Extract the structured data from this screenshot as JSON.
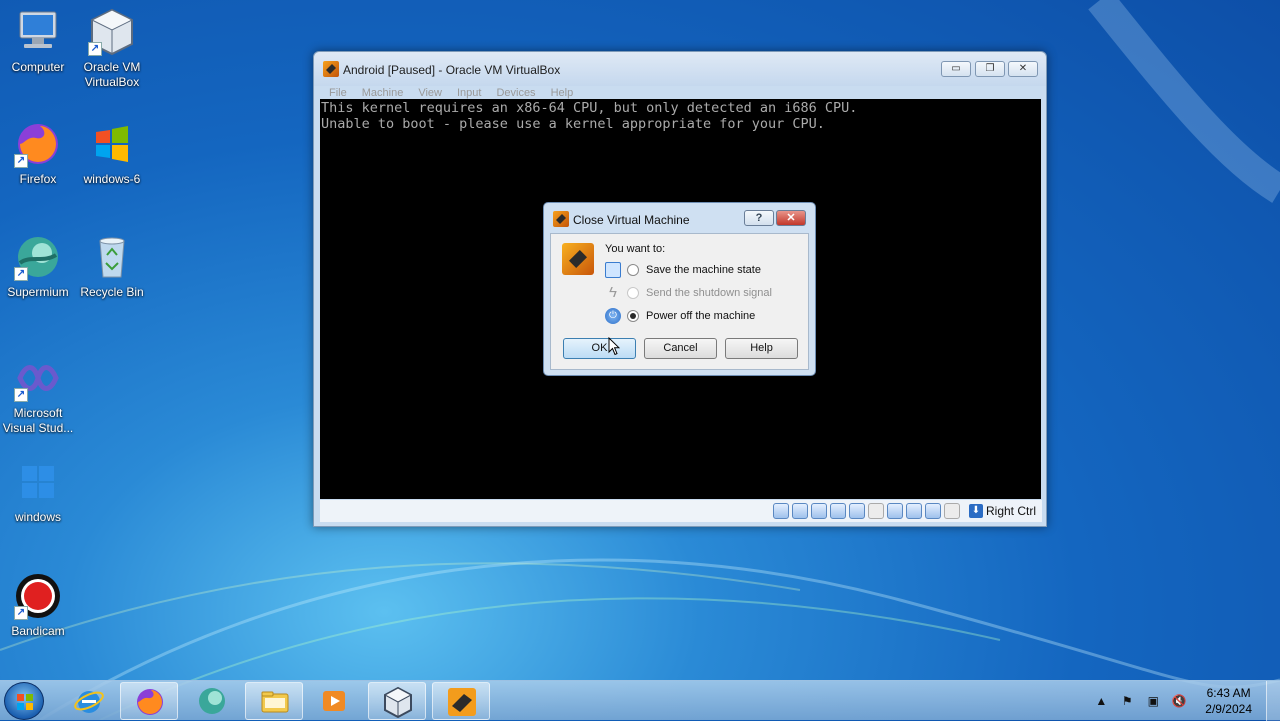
{
  "desktop": {
    "icons": [
      {
        "label": "Computer",
        "icon": "computer-icon"
      },
      {
        "label": "Oracle VM VirtualBox",
        "icon": "virtualbox-icon"
      },
      {
        "label": "Firefox",
        "icon": "firefox-icon"
      },
      {
        "label": "windows-6",
        "icon": "windows-logo-icon"
      },
      {
        "label": "Supermium",
        "icon": "supermium-icon"
      },
      {
        "label": "Recycle Bin",
        "icon": "recycle-bin-icon"
      },
      {
        "label": "Microsoft Visual Stud...",
        "icon": "visual-studio-icon"
      },
      {
        "label": "windows",
        "icon": "windows-logo-icon"
      },
      {
        "label": "Bandicam",
        "icon": "bandicam-icon"
      }
    ]
  },
  "vbox": {
    "title": "Android [Paused] - Oracle VM VirtualBox",
    "menu": [
      "File",
      "Machine",
      "View",
      "Input",
      "Devices",
      "Help"
    ],
    "console": [
      "This kernel requires an x86-64 CPU, but only detected an i686 CPU.",
      "Unable to boot - please use a kernel appropriate for your CPU."
    ],
    "host_key": "Right Ctrl"
  },
  "dialog": {
    "title": "Close Virtual Machine",
    "prompt": "You want to:",
    "options": [
      {
        "label": "Save the machine state",
        "checked": false,
        "enabled": true
      },
      {
        "label": "Send the shutdown signal",
        "checked": false,
        "enabled": false
      },
      {
        "label": "Power off the machine",
        "checked": true,
        "enabled": true
      }
    ],
    "buttons": {
      "ok": "OK",
      "cancel": "Cancel",
      "help": "Help"
    }
  },
  "taskbar": {
    "apps": [
      "internet-explorer-icon",
      "firefox-icon",
      "supermium-icon",
      "file-explorer-icon",
      "media-player-icon",
      "virtualbox-icon",
      "virtualbox-vm-icon"
    ],
    "clock": {
      "time": "6:43 AM",
      "date": "2/9/2024"
    }
  }
}
